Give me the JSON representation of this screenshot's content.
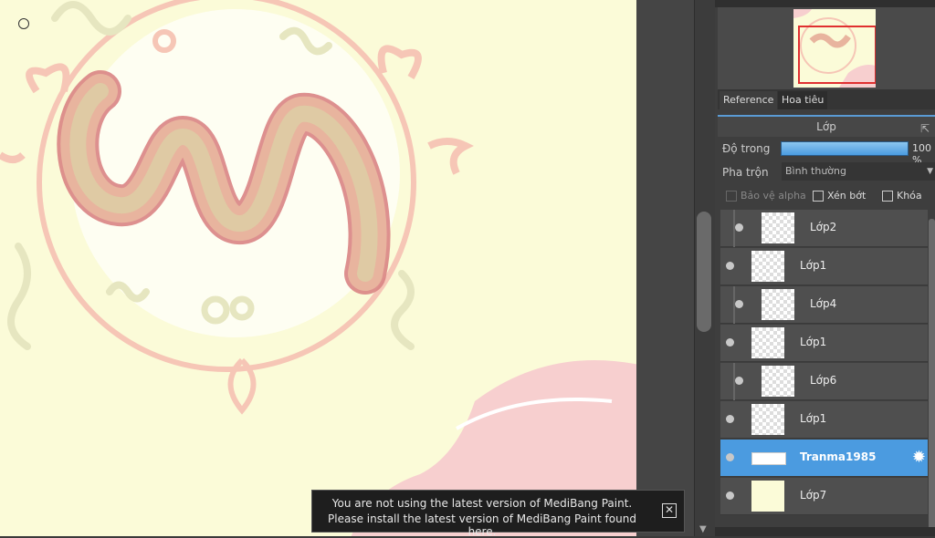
{
  "reference_panel": {
    "tabs": [
      {
        "label": "Reference",
        "active": true
      },
      {
        "label": "Hoa tiêu",
        "active": false
      }
    ]
  },
  "layers_panel": {
    "title": "Lớp",
    "opacity_label": "Độ trong",
    "opacity_value": "100 %",
    "blend_label": "Pha trộn",
    "blend_value": "Bình thường",
    "checkboxes": {
      "protect_alpha": "Bảo vệ alpha",
      "clipping": "Xén bớt",
      "lock": "Khóa"
    },
    "layers": [
      {
        "name": "Lớp2",
        "clipped": true,
        "selected": false
      },
      {
        "name": "Lớp1",
        "clipped": false,
        "selected": false
      },
      {
        "name": "Lớp4",
        "clipped": true,
        "selected": false
      },
      {
        "name": "Lớp1",
        "clipped": false,
        "selected": false
      },
      {
        "name": "Lớp6",
        "clipped": true,
        "selected": false
      },
      {
        "name": "Lớp1",
        "clipped": false,
        "selected": false
      },
      {
        "name": "Tranma1985",
        "clipped": false,
        "selected": true
      },
      {
        "name": "Lớp7",
        "clipped": false,
        "selected": false
      }
    ]
  },
  "notification": {
    "line1": "You are not using the latest version of MediBang Paint.",
    "line2": "Please install the latest version of MediBang Paint found here."
  },
  "colors": {
    "canvas_bg": "#fbfbd8",
    "accent_blue": "#4b9be0",
    "panel_bg": "#3e3e3e"
  }
}
